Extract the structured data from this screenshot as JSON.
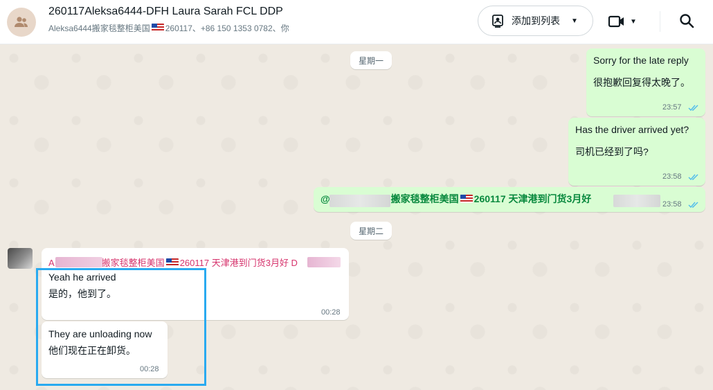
{
  "header": {
    "title": "260117Aleksa6444-DFH Laura Sarah FCL DDP",
    "subtitle_pre": "Aleksa6444搬家毯整柜美国",
    "subtitle_post": "260117、+86 150 1353 0782、你",
    "add_to_list": "添加到列表"
  },
  "icons": {
    "group_avatar": "group-avatar-icon",
    "contact_card": "contact-card-icon",
    "video": "video-call-icon",
    "search": "search-icon",
    "read_receipt": "double-check-icon"
  },
  "colors": {
    "outgoing_bubble": "#d9fdd3",
    "incoming_bubble": "#ffffff",
    "read_tick": "#53bdeb",
    "mention": "#07883d",
    "sender_name": "#d6336c",
    "highlight": "#29aaf0"
  },
  "chat": {
    "day1": "星期一",
    "day2": "星期二",
    "m1": {
      "line1": "Sorry for the late reply",
      "line2": "很抱歉回复得太晚了。",
      "time": "23:57"
    },
    "m2": {
      "line1": "Has the driver arrived yet?",
      "line2": "司机已经到了吗?",
      "time": "23:58"
    },
    "m3": {
      "prefix": "@",
      "text": "搬家毯整柜美国",
      "text2": "260117 天津港到门货3月好",
      "time": "23:58"
    },
    "m4": {
      "sender_prefix": "A",
      "sender": "搬家毯整柜美国",
      "sender2": "260117 天津港到门货3月好 D",
      "line1": "Yeah he arrived",
      "line2": "是的，他到了。",
      "time": "00:28"
    },
    "m5": {
      "line1": "They are unloading now",
      "line2": "他们现在正在卸货。",
      "time": "00:28"
    }
  }
}
